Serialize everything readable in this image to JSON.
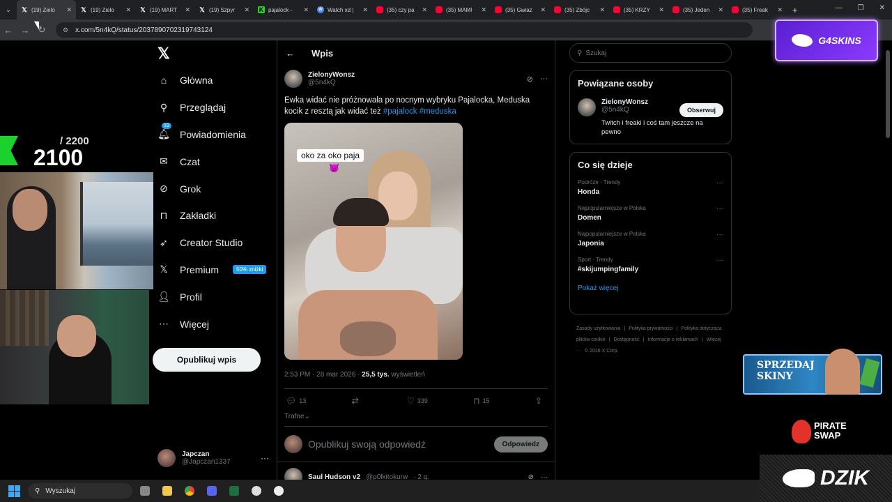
{
  "browser": {
    "tabs": [
      {
        "title": "(19) Zielo",
        "favicon": "x-icon",
        "active": true
      },
      {
        "title": "(19) Zielo",
        "favicon": "x-icon"
      },
      {
        "title": "(19) MART",
        "favicon": "x-icon"
      },
      {
        "title": "(19) Szpyr",
        "favicon": "x-icon"
      },
      {
        "title": "pajalock -",
        "favicon": "kick-icon"
      },
      {
        "title": "Watch xd |",
        "favicon": "watch-icon"
      },
      {
        "title": "(35) czy pa",
        "favicon": "youtube-icon"
      },
      {
        "title": "(35) MAMI",
        "favicon": "youtube-icon"
      },
      {
        "title": "(35) Gwiaz",
        "favicon": "youtube-icon"
      },
      {
        "title": "(35) Zbójc",
        "favicon": "youtube-icon"
      },
      {
        "title": "(35) KRZY",
        "favicon": "youtube-icon"
      },
      {
        "title": "(35) Jeden",
        "favicon": "youtube-icon"
      },
      {
        "title": "(35) Freak",
        "favicon": "youtube-icon"
      }
    ],
    "new_tab": "+",
    "url": "x.com/5n4kQ/status/2037890702319743124"
  },
  "overlays": {
    "top_promo": "G4SKINS",
    "counter_max": "/ 2200",
    "counter_current": "2100",
    "sell_promo_line1": "SPRZEDAJ",
    "sell_promo_line2": "SKINY",
    "pirate_line1": "PIRATE",
    "pirate_line2": "SWAP",
    "dzik": "DZIK"
  },
  "nav": {
    "items": [
      {
        "label": "Główna",
        "icon": "home-icon"
      },
      {
        "label": "Przeglądaj",
        "icon": "search-icon"
      },
      {
        "label": "Powiadomienia",
        "icon": "bell-icon",
        "badge": "19"
      },
      {
        "label": "Czat",
        "icon": "mail-icon"
      },
      {
        "label": "Grok",
        "icon": "grok-icon"
      },
      {
        "label": "Zakładki",
        "icon": "bookmark-icon"
      },
      {
        "label": "Creator Studio",
        "icon": "rocket-icon"
      },
      {
        "label": "Premium",
        "icon": "x-icon",
        "promo": "50% zniżki"
      },
      {
        "label": "Profil",
        "icon": "person-icon"
      },
      {
        "label": "Więcej",
        "icon": "more-icon"
      }
    ],
    "publish_label": "Opublikuj wpis",
    "account_name": "Japczan",
    "account_handle": "@Japczan1337"
  },
  "main": {
    "header_title": "Wpis",
    "tweet": {
      "author_name": "ZielonyWonsz",
      "author_handle": "@5n4kQ",
      "text_before": "Ewka widać nie próżnowała po nocnym wybryku Pajalocka, Meduska kocik z resztą jak widać też ",
      "hashtag1": "#pajalock",
      "hashtag2": "#meduska",
      "media_caption": "oko za oko paja",
      "time": "2:53 PM · 28 mar 2026 · ",
      "views": "25,5 tys.",
      "views_label": " wyświetleń",
      "replies": "13",
      "reposts": "",
      "likes": "339",
      "bookmarks": "15"
    },
    "sort_label": "Trafne",
    "reply_placeholder": "Opublikuj swoją odpowiedź",
    "reply_button": "Odpowiedz",
    "next_tweet": {
      "author_name": "Saul Hudson v2",
      "author_handle": "@p0lkitokurw",
      "time": "· 2 g."
    }
  },
  "right": {
    "search_placeholder": "Szukaj",
    "related_title": "Powiązane osoby",
    "related_name": "ZielonyWonsz",
    "related_handle": "@5n4kQ",
    "related_bio": "Twitch i freaki i coś tam jeszcze na pewno",
    "follow_label": "Obserwuj",
    "trends_title": "Co się dzieje",
    "trends": [
      {
        "category": "Podróże · Trendy",
        "title": "Honda"
      },
      {
        "category": "Najpopularniejsze w Polska",
        "title": "Domen"
      },
      {
        "category": "Najpopularniejsze w Polska",
        "title": "Japonia"
      },
      {
        "category": "Sport · Trendy",
        "title": "#skijumpingfamily"
      }
    ],
    "show_more": "Pokaż więcej",
    "footer": [
      "Zasady użytkowania",
      "|",
      "Polityka prywatności",
      "|",
      "Polityka dotycząca plików cookie",
      "|",
      "Dostępność",
      "|",
      "Informacje o reklamach",
      "|",
      "Więcej ···",
      "© 2026 X Corp."
    ]
  },
  "taskbar": {
    "search_placeholder": "Wyszukaj"
  }
}
